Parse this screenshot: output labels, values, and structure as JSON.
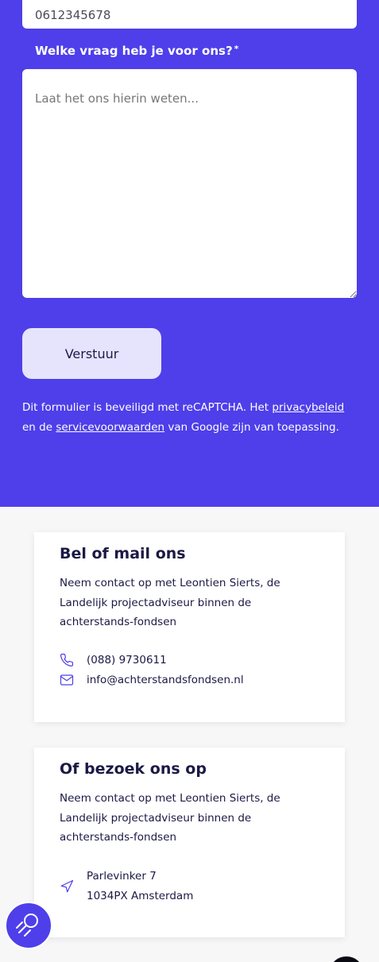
{
  "form": {
    "phone_value": "0612345678",
    "question_label": "Welke vraag heb je voor ons?",
    "required_marker": "*",
    "question_placeholder": "Laat het ons hierin weten...",
    "submit_label": "Verstuur",
    "recaptcha_text_1": "Dit formulier is beveiligd met reCAPTCHA. Het ",
    "privacy_link": "privacybeleid",
    "recaptcha_text_2": " en de ",
    "terms_link": "servicevoorwaarden",
    "recaptcha_text_3": " van Google zijn van toepassing."
  },
  "contact_card": {
    "title": "Bel of mail ons",
    "description": "Neem contact op met Leontien Sierts, de Landelijk projectadviseur binnen de achterstands-fondsen",
    "phone": "(088) 9730611",
    "phone_icon": "phone-icon",
    "email": "info@achterstandsfondsen.nl",
    "email_icon": "mail-icon"
  },
  "visit_card": {
    "title": "Of bezoek ons op",
    "description": "Neem contact op met Leontien Sierts, de Landelijk projectadviseur binnen de achterstands-fondsen",
    "address_icon": "navigation-arrow-icon",
    "address_line1": "Parlevinker 7",
    "address_line2": "1034PX Amsterdam"
  },
  "colors": {
    "brand_purple": "#4e3fea",
    "button_bg": "#e6e4fc",
    "heading_navy": "#1b1945"
  },
  "search_button": {
    "icon": "search-icon"
  }
}
